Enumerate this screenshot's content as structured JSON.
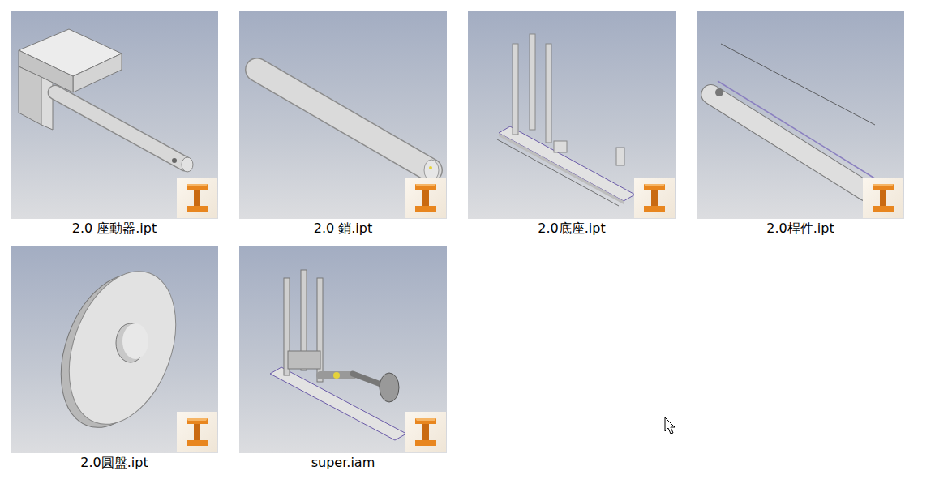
{
  "files": [
    {
      "name": "2.0 座動器.ipt",
      "kind": "actuator",
      "selected": false
    },
    {
      "name": "2.0 銷.ipt",
      "kind": "pin",
      "selected": false
    },
    {
      "name": "2.0底座.ipt",
      "kind": "base",
      "selected": false
    },
    {
      "name": "2.0桿件.ipt",
      "kind": "link",
      "selected": false
    },
    {
      "name": "2.0圓盤.ipt",
      "kind": "disc",
      "selected": false
    },
    {
      "name": "super.iam",
      "kind": "assembly",
      "selected": false
    }
  ]
}
